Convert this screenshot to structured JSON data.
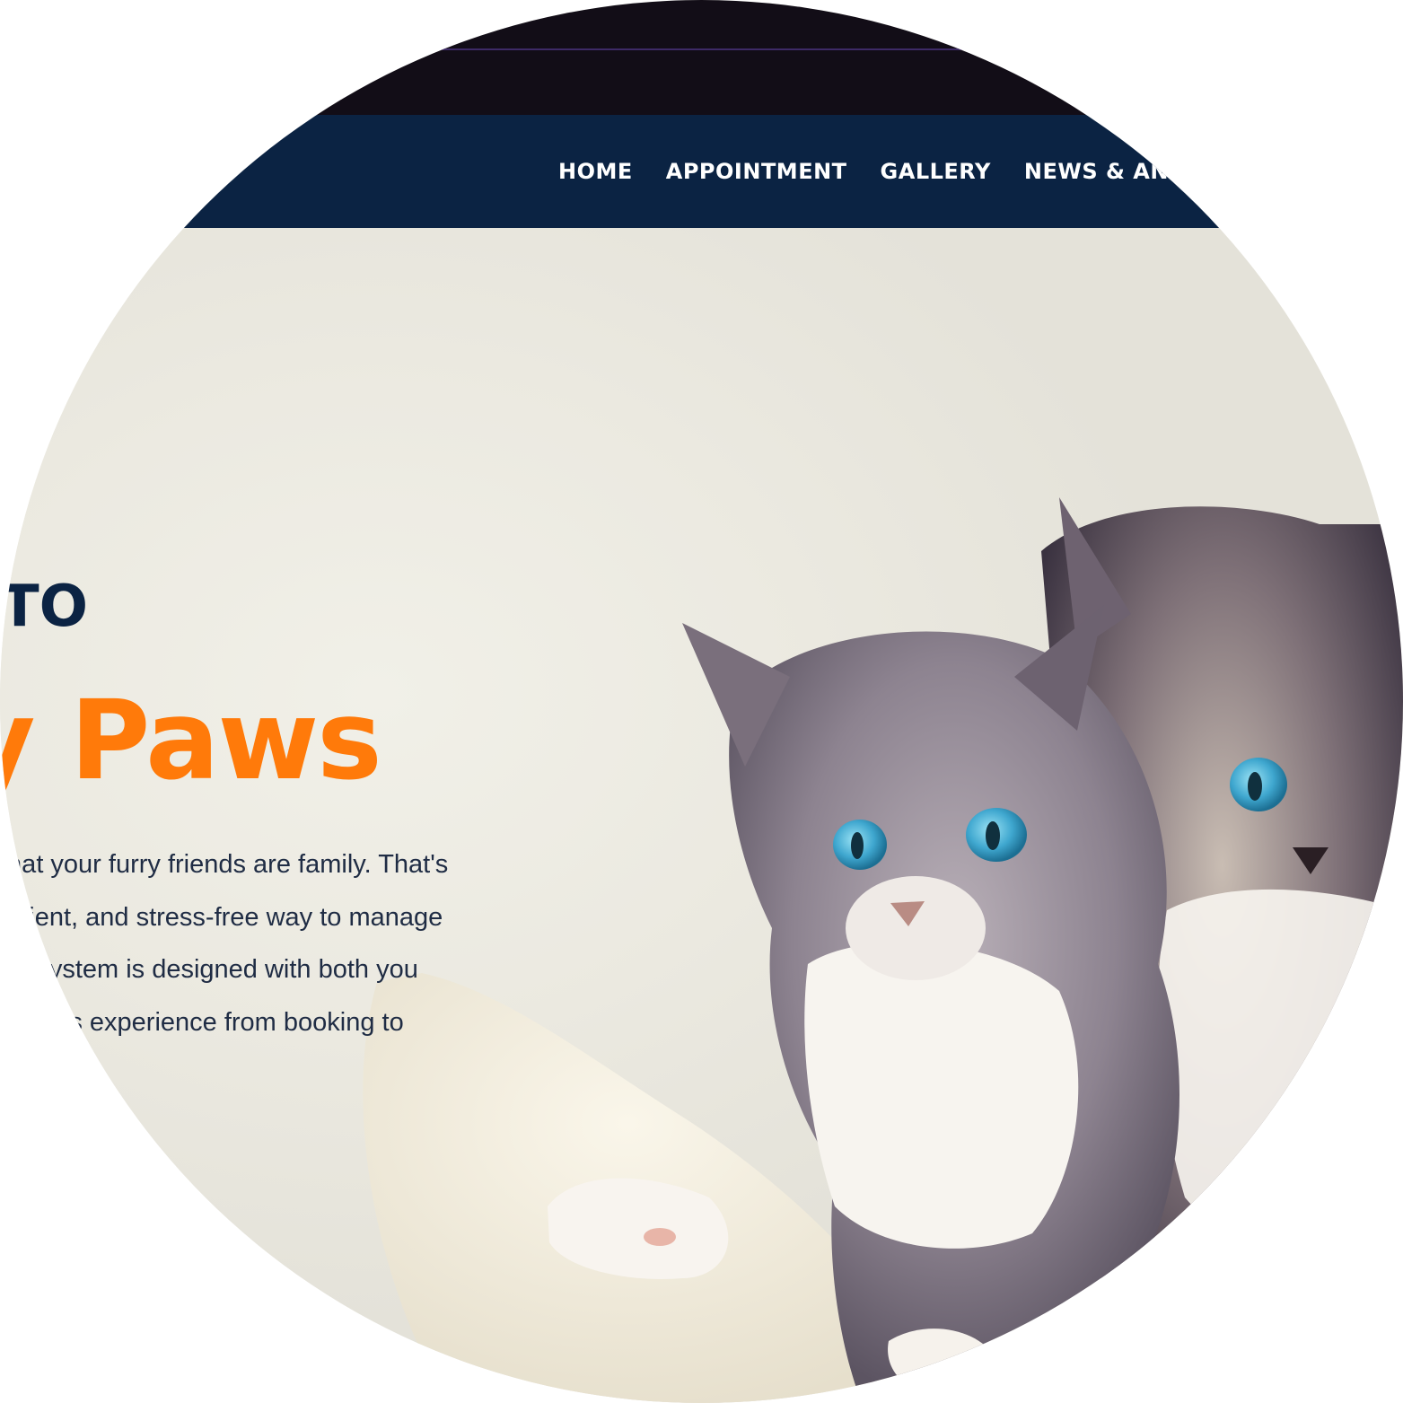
{
  "nav": {
    "items": [
      {
        "label": "HOME"
      },
      {
        "label": "APPOINTMENT"
      },
      {
        "label": "GALLERY"
      },
      {
        "label": "NEWS & AN"
      }
    ]
  },
  "hero": {
    "welcome": "TO",
    "brand": "y Paws",
    "intro_lines": [
      "that your furry friends are family. That's",
      "enient, and stress-free way to manage",
      "he system is designed with both you",
      "amless experience from booking to"
    ],
    "image_icon": "kittens-photo"
  },
  "colors": {
    "top_strip": "#120d17",
    "navbar": "#0b2343",
    "accent": "#ff7a0a",
    "heading": "#0b2343",
    "body_text": "#1f2c44",
    "background": "#ecebe3"
  }
}
